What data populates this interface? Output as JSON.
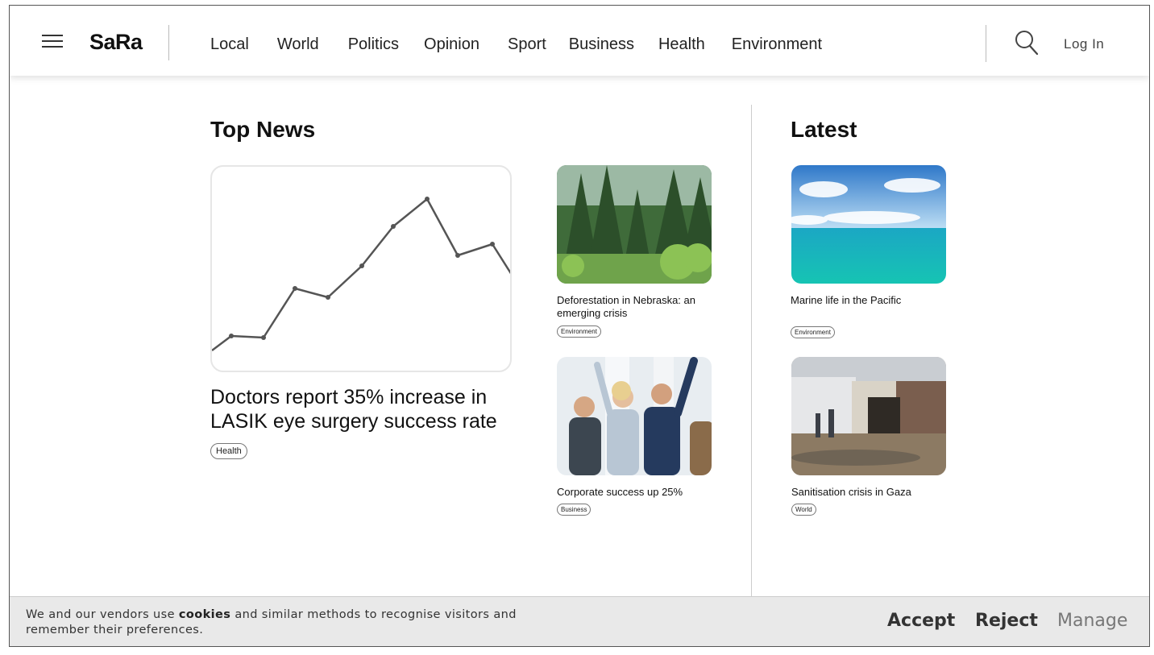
{
  "header": {
    "logo": "SaRa",
    "nav": [
      "Local",
      "World",
      "Politics",
      "Opinion",
      "Sport",
      "Business",
      "Health",
      "Environment"
    ],
    "login_label": "Log In"
  },
  "top_news": {
    "title": "Top News",
    "main": {
      "headline": "Doctors report 35% increase in LASIK eye surgery success rate",
      "tag": "Health"
    },
    "side": [
      {
        "headline": "Deforestation in Nebraska: an emerging crisis",
        "tag": "Environment",
        "image": "forest-photo"
      },
      {
        "headline": "Corporate success up 25%",
        "tag": "Business",
        "image": "celebrating-team-photo"
      }
    ]
  },
  "latest": {
    "title": "Latest",
    "items": [
      {
        "headline": "Marine life in the Pacific",
        "tag": "Environment",
        "image": "ocean-photo"
      },
      {
        "headline": "Sanitisation crisis in Gaza",
        "tag": "World",
        "image": "camp-photo"
      }
    ]
  },
  "cookie_banner": {
    "text_before": "We and our vendors use ",
    "text_bold": "cookies",
    "text_after": " and similar methods to recognise visitors and remember their preferences.",
    "accept": "Accept",
    "reject": "Reject",
    "manage": "Manage"
  },
  "colors": {
    "accept": "#333333",
    "reject": "#333333",
    "manage": "#777777",
    "banner_bg": "#e9e9e9"
  },
  "icons": [
    "menu-icon",
    "search-icon"
  ]
}
